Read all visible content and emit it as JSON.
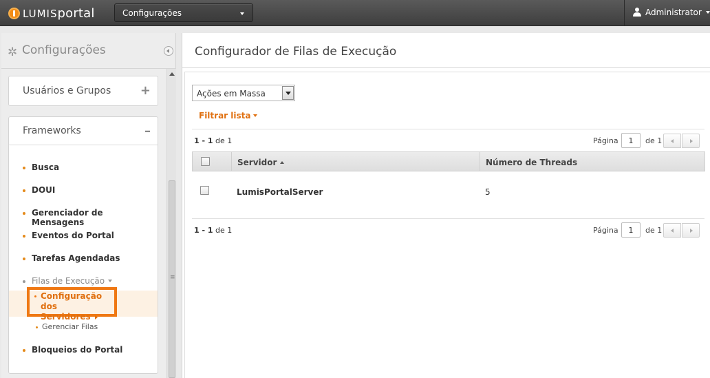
{
  "topbar": {
    "logo_prefix": "LUMIS",
    "logo_suffix": "portal",
    "context_select": "Configurações",
    "user_name": "Administrator"
  },
  "sidebar": {
    "title": "Configurações",
    "sections": [
      {
        "label": "Usuários e Grupos",
        "sign": "+"
      },
      {
        "label": "Frameworks",
        "sign": "–"
      }
    ],
    "items": [
      {
        "label": "Busca"
      },
      {
        "label": "DOUI"
      },
      {
        "label": "Gerenciador de Mensagens"
      },
      {
        "label": "Eventos do Portal"
      },
      {
        "label": "Tarefas Agendadas"
      },
      {
        "label": "Filas de Execução"
      },
      {
        "label": "Bloqueios do Portal"
      }
    ],
    "subitems": [
      {
        "label_line1": "Configuração dos",
        "label_line2": "Servidores"
      },
      {
        "label": "Gerenciar Filas"
      }
    ]
  },
  "main": {
    "title": "Configurador de Filas de Execução",
    "mass_actions": "Ações em Massa",
    "filter_label": "Filtrar lista",
    "pager": {
      "range": "1 - 1",
      "of_text": "de 1",
      "page_label": "Página",
      "page_value": "1",
      "total_text": "de 1"
    },
    "table": {
      "columns": [
        "Servidor",
        "Número de Threads"
      ],
      "rows": [
        {
          "server": "LumisPortalServer",
          "threads": "5"
        }
      ]
    }
  },
  "colors": {
    "accent": "#e07010",
    "topbar": "#4a4a4a"
  }
}
